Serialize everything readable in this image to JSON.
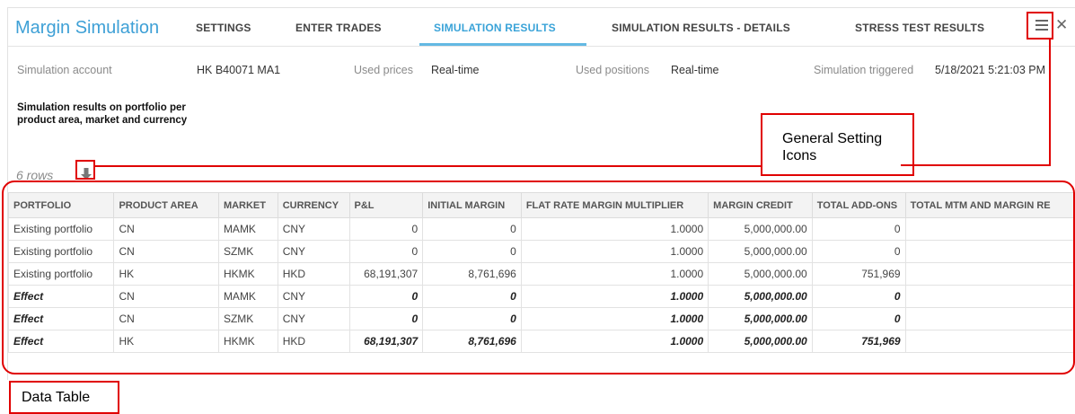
{
  "app": {
    "title": "Margin Simulation"
  },
  "tabs": [
    {
      "label": "SETTINGS",
      "active": false
    },
    {
      "label": "ENTER TRADES",
      "active": false
    },
    {
      "label": "SIMULATION RESULTS",
      "active": true
    },
    {
      "label": "SIMULATION RESULTS - DETAILS",
      "active": false
    },
    {
      "label": "STRESS TEST RESULTS",
      "active": false
    }
  ],
  "header_icons": [
    "menu-icon",
    "close-icon"
  ],
  "info": {
    "account_label": "Simulation account",
    "account_value": "HK B40071 MA1",
    "prices_label": "Used prices",
    "prices_value": "Real-time",
    "positions_label": "Used positions",
    "positions_value": "Real-time",
    "triggered_label": "Simulation triggered",
    "triggered_value": "5/18/2021 5:21:03 PM"
  },
  "heading": "Simulation results on portfolio per product area, market and currency",
  "rows_count": "6 rows",
  "table": {
    "columns": [
      "PORTFOLIO",
      "PRODUCT AREA",
      "MARKET",
      "CURRENCY",
      "P&L",
      "INITIAL MARGIN",
      "FLAT RATE MARGIN MULTIPLIER",
      "MARGIN CREDIT",
      "TOTAL ADD-ONS",
      "TOTAL MTM AND MARGIN RE"
    ],
    "rows": [
      [
        "Existing portfolio",
        "CN",
        "MAMK",
        "CNY",
        "0",
        "0",
        "1.0000",
        "5,000,000.00",
        "0",
        ""
      ],
      [
        "Existing portfolio",
        "CN",
        "SZMK",
        "CNY",
        "0",
        "0",
        "1.0000",
        "5,000,000.00",
        "0",
        ""
      ],
      [
        "Existing portfolio",
        "HK",
        "HKMK",
        "HKD",
        "68,191,307",
        "8,761,696",
        "1.0000",
        "5,000,000.00",
        "751,969",
        ""
      ],
      [
        "Effect",
        "CN",
        "MAMK",
        "CNY",
        "0",
        "0",
        "1.0000",
        "5,000,000.00",
        "0",
        ""
      ],
      [
        "Effect",
        "CN",
        "SZMK",
        "CNY",
        "0",
        "0",
        "1.0000",
        "5,000,000.00",
        "0",
        ""
      ],
      [
        "Effect",
        "HK",
        "HKMK",
        "HKD",
        "68,191,307",
        "8,761,696",
        "1.0000",
        "5,000,000.00",
        "751,969",
        ""
      ]
    ]
  },
  "annotations": {
    "general_settings": "General Setting Icons",
    "data_table": "Data Table"
  },
  "colors": {
    "accent": "#3ea0d6",
    "annotation": "#e00000"
  }
}
